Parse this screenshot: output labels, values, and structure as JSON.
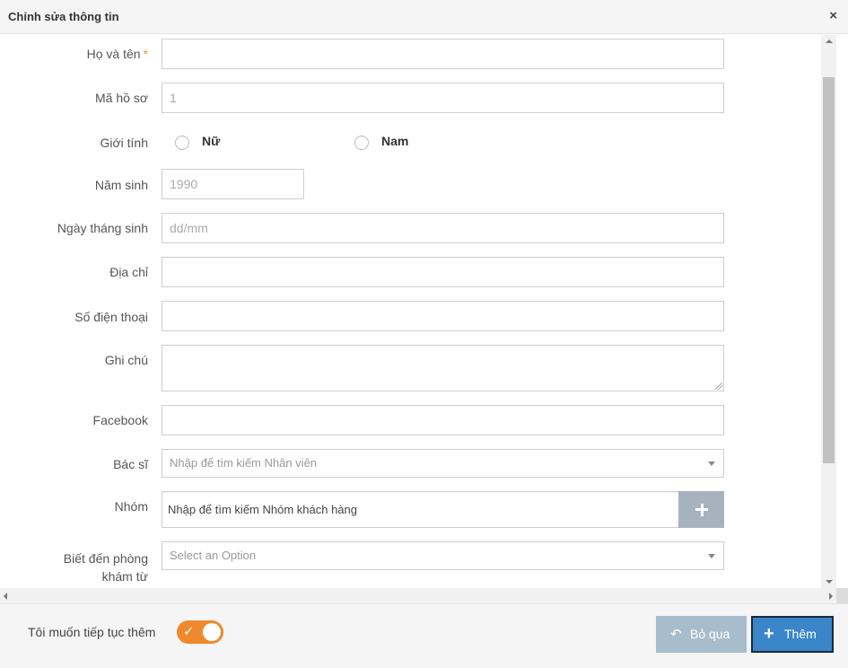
{
  "dialog": {
    "title": "Chỉnh sửa thông tin",
    "close_icon": "×"
  },
  "form": {
    "full_name": {
      "label": "Họ và tên",
      "required_mark": "*",
      "value": ""
    },
    "profile_code": {
      "label": "Mã hồ sơ",
      "value": "1"
    },
    "gender": {
      "label": "Giới tính",
      "option_female": "Nữ",
      "option_male": "Nam"
    },
    "birth_year": {
      "label": "Năm sinh",
      "value": "1990"
    },
    "birth_date": {
      "label": "Ngày tháng sinh",
      "placeholder": "dd/mm",
      "value": ""
    },
    "address": {
      "label": "Địa chỉ",
      "value": ""
    },
    "phone": {
      "label": "Số điện thoại",
      "value": ""
    },
    "note": {
      "label": "Ghi chú",
      "value": ""
    },
    "facebook": {
      "label": "Facebook",
      "value": ""
    },
    "doctor": {
      "label": "Bác sĩ",
      "placeholder": "Nhập để tìm kiếm Nhân viên"
    },
    "group": {
      "label": "Nhóm",
      "placeholder": "Nhập để tìm kiếm Nhóm khách hàng",
      "add_icon": "plus-icon"
    },
    "referral": {
      "label_line1": "Biết đến phòng",
      "label_line2": "khám từ",
      "placeholder": "Select an Option"
    }
  },
  "footer": {
    "continue_label": "Tôi muốn tiếp tục thêm",
    "continue_toggle_on": true,
    "skip_button": "Bỏ qua",
    "skip_icon": "↶",
    "add_button": "Thêm",
    "add_icon": "+"
  },
  "colors": {
    "required": "#f0922b",
    "toggle": "#f0892e",
    "add_button": "#3a86c8",
    "skip_button": "#a8bdcc",
    "group_add": "#a6b3bf"
  }
}
